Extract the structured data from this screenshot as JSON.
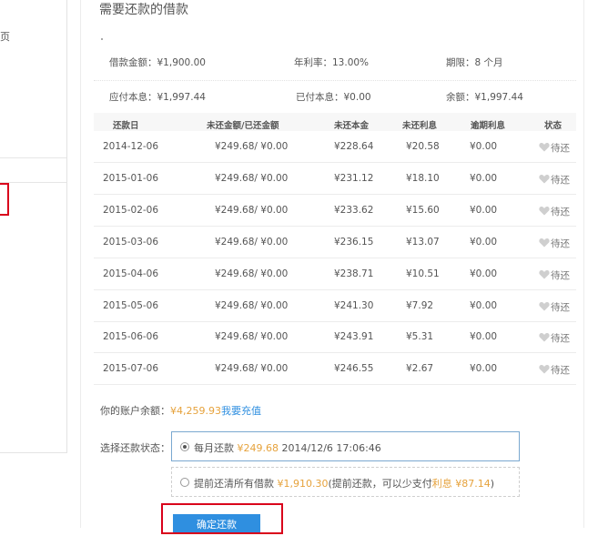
{
  "sidebar": {
    "home_fragment": "页"
  },
  "page": {
    "title": "需要还款的借款"
  },
  "summary": {
    "loan_amount": "借款金额：¥1,900.00",
    "annual_rate": "年利率：13.00%",
    "term": "期限：8 个月",
    "principal_interest_due": "应付本息：¥1,997.44",
    "paid_principal_interest": "已付本息：¥0.00",
    "remaining": "余额：¥1,997.44"
  },
  "table": {
    "headers": [
      "还款日",
      "未还金额/已还金额",
      "未还本金",
      "未还利息",
      "逾期利息",
      "状态"
    ],
    "rows": [
      [
        "2014-12-06",
        "¥249.68/ ¥0.00",
        "¥228.64",
        "¥20.58",
        "¥0.00",
        "待还"
      ],
      [
        "2015-01-06",
        "¥249.68/ ¥0.00",
        "¥231.12",
        "¥18.10",
        "¥0.00",
        "待还"
      ],
      [
        "2015-02-06",
        "¥249.68/ ¥0.00",
        "¥233.62",
        "¥15.60",
        "¥0.00",
        "待还"
      ],
      [
        "2015-03-06",
        "¥249.68/ ¥0.00",
        "¥236.15",
        "¥13.07",
        "¥0.00",
        "待还"
      ],
      [
        "2015-04-06",
        "¥249.68/ ¥0.00",
        "¥238.71",
        "¥10.51",
        "¥0.00",
        "待还"
      ],
      [
        "2015-05-06",
        "¥249.68/ ¥0.00",
        "¥241.30",
        "¥7.92",
        "¥0.00",
        "待还"
      ],
      [
        "2015-06-06",
        "¥249.68/ ¥0.00",
        "¥243.91",
        "¥5.31",
        "¥0.00",
        "待还"
      ],
      [
        "2015-07-06",
        "¥249.68/ ¥0.00",
        "¥246.55",
        "¥2.67",
        "¥0.00",
        "待还"
      ]
    ]
  },
  "account": {
    "balance_label": "你的账户余额：",
    "balance_value": "¥4,259.93",
    "recharge_link": "我要充值"
  },
  "repayment": {
    "label": "选择还款状态：",
    "monthly": {
      "prefix": "每月还款",
      "amount": "¥249.68",
      "datetime": "2014/12/6 17:06:46"
    },
    "early": {
      "prefix": "提前还清所有借款",
      "amount": "¥1,910.30",
      "note_open": "(提前还款，可以少支付",
      "interest_word": "利息",
      "interest_amount": "¥87.14",
      "note_close": ")"
    }
  },
  "actions": {
    "confirm": "确定还款"
  },
  "colors": {
    "accent_blue": "#2f8fe0",
    "highlight_orange": "#e6a23c",
    "annotation_red": "#d9001b"
  }
}
